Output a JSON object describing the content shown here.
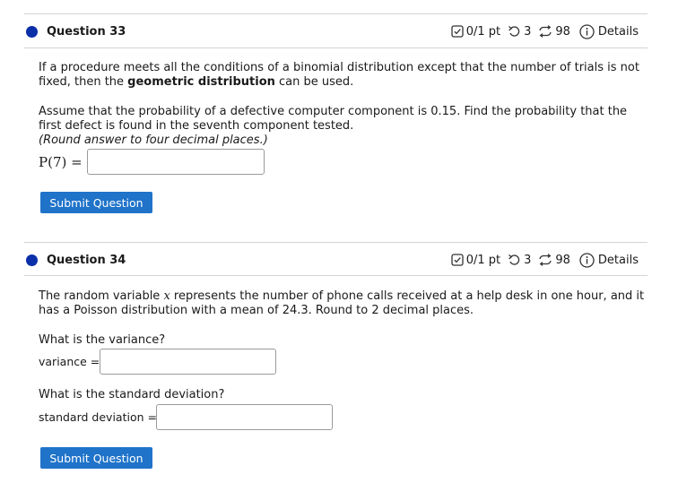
{
  "colors": {
    "accent": "#1f73c9",
    "dot": "#0b2fa8"
  },
  "q33": {
    "title": "Question 33",
    "score": "0/1 pt",
    "retries": "3",
    "attempts": "98",
    "details_label": "Details",
    "intro_1": "If a procedure meets all the conditions of a binomial distribution except that the number of trials is not fixed, then the ",
    "intro_bold": "geometric distribution",
    "intro_2": " can be used.",
    "problem": "Assume that the probability of a defective computer component is 0.15. Find the probability that the first defect is found in the seventh component tested.",
    "hint": "(Round answer to four decimal places.)",
    "answer_label": "P(7) =",
    "answer_value": "",
    "submit_label": "Submit Question"
  },
  "q34": {
    "title": "Question 34",
    "score": "0/1 pt",
    "retries": "3",
    "attempts": "98",
    "details_label": "Details",
    "intro_1": "The random variable ",
    "intro_var": "x",
    "intro_2": " represents the number of phone calls received at a help desk in one hour, and it has a Poisson distribution with a mean of 24.3. Round to 2 decimal places.",
    "variance_question": "What is the variance?",
    "variance_label": "variance =",
    "variance_value": "",
    "sd_question": "What is the standard deviation?",
    "sd_label": "standard deviation =",
    "sd_value": "",
    "submit_label": "Submit Question"
  }
}
